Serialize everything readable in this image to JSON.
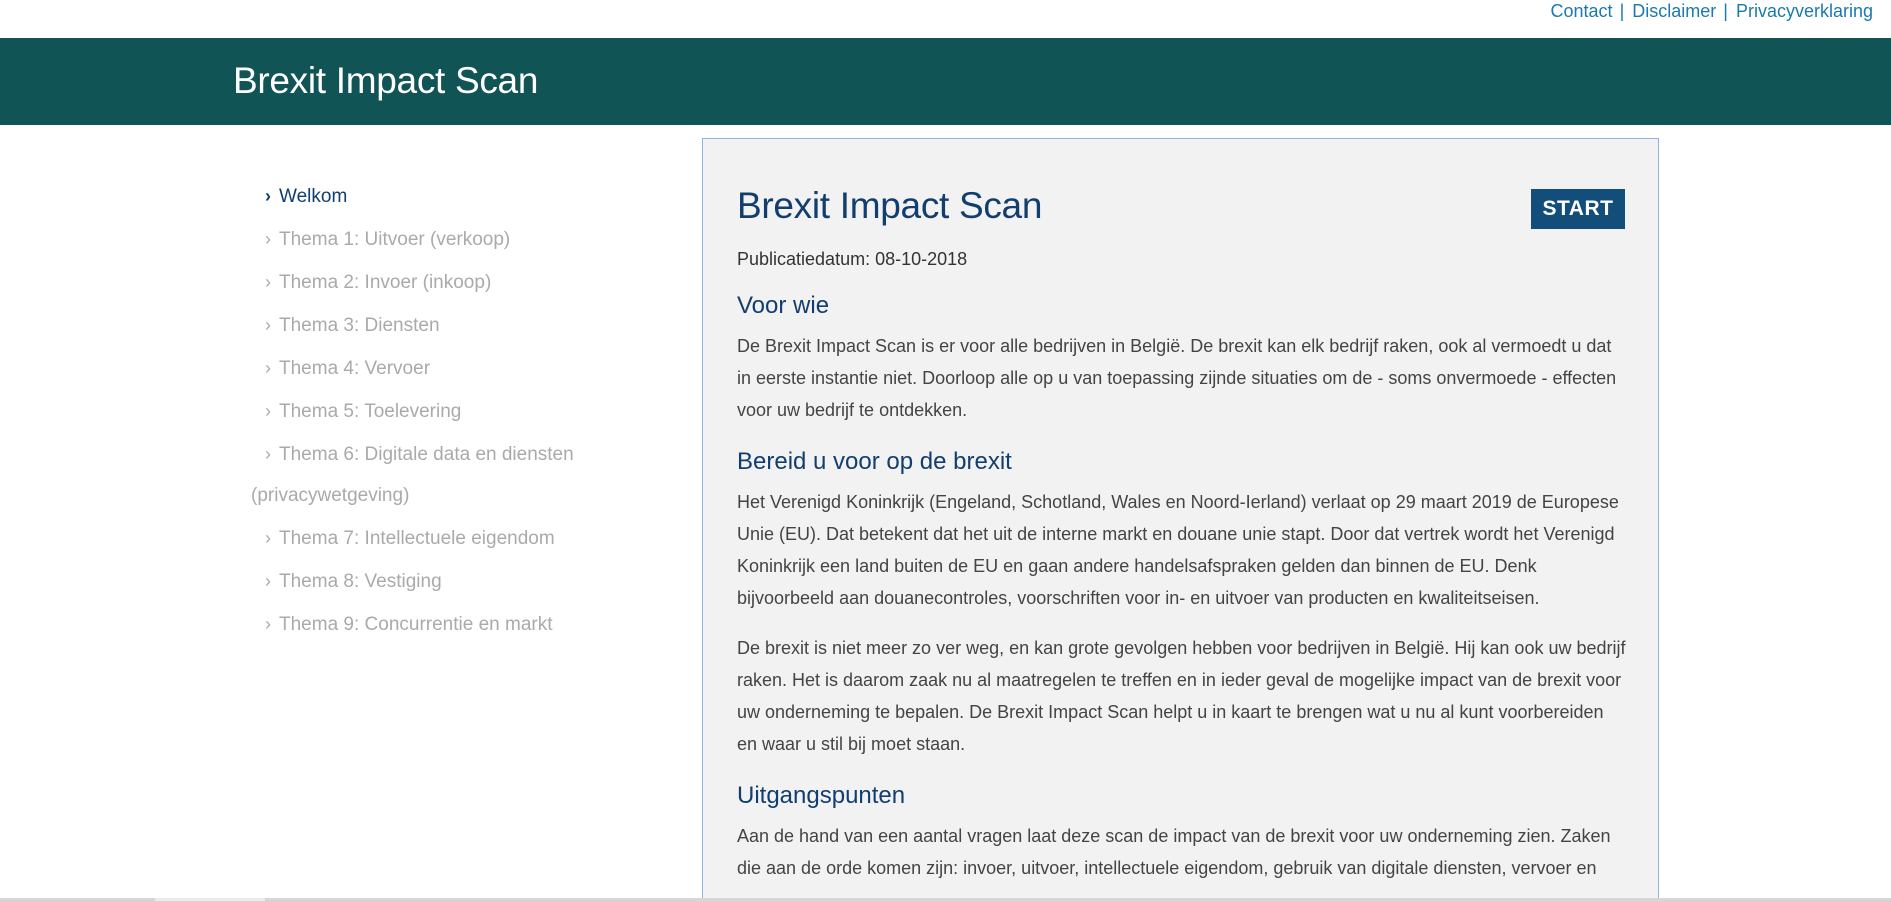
{
  "toplinks": {
    "contact": "Contact",
    "disclaimer": "Disclaimer",
    "privacy": "Privacyverklaring",
    "separator": "|"
  },
  "header": {
    "brand": "Brexit Impact Scan"
  },
  "sidebar": {
    "items": [
      {
        "label": "Welkom",
        "active": true
      },
      {
        "label": "Thema 1: Uitvoer (verkoop)",
        "active": false
      },
      {
        "label": "Thema 2: Invoer (inkoop)",
        "active": false
      },
      {
        "label": "Thema 3: Diensten",
        "active": false
      },
      {
        "label": "Thema 4: Vervoer",
        "active": false
      },
      {
        "label": "Thema 5: Toelevering",
        "active": false
      },
      {
        "label": "Thema 6: Digitale data en diensten",
        "label_cont": "(privacywetgeving)",
        "active": false
      },
      {
        "label": "Thema 7: Intellectuele eigendom",
        "active": false
      },
      {
        "label": "Thema 8: Vestiging",
        "active": false
      },
      {
        "label": "Thema 9: Concurrentie en markt",
        "active": false
      }
    ],
    "chevron": "›"
  },
  "main": {
    "title": "Brexit Impact Scan",
    "start_label": "START",
    "pubdate": "Publicatiedatum: 08-10-2018",
    "sections": [
      {
        "heading": "Voor wie",
        "paragraphs": [
          "De Brexit Impact Scan is er voor alle bedrijven in België. De brexit kan elk bedrijf raken, ook al vermoedt u dat in eerste instantie niet. Doorloop alle op u van toepassing zijnde situaties om de - soms onvermoede - effecten voor uw bedrijf te ontdekken."
        ]
      },
      {
        "heading": "Bereid u voor op de brexit",
        "paragraphs": [
          "Het Verenigd Koninkrijk (Engeland, Schotland, Wales en Noord-Ierland) verlaat op 29 maart 2019 de Europese Unie (EU). Dat betekent dat het uit de interne markt en douane unie stapt. Door dat vertrek wordt het Verenigd Koninkrijk een land buiten de EU en gaan andere handelsafspraken gelden dan binnen de EU. Denk bijvoorbeeld aan douanecontroles, voorschriften voor in- en uitvoer van producten en kwaliteitseisen.",
          "De brexit is niet meer zo ver weg, en kan grote gevolgen hebben voor bedrijven in België. Hij kan ook uw bedrijf raken. Het is daarom zaak nu al maatregelen te treffen en in ieder geval de mogelijke impact van de brexit voor uw onderneming te bepalen. De Brexit Impact Scan helpt u in kaart te brengen wat u nu al kunt voorbereiden en waar u stil bij moet staan."
        ]
      },
      {
        "heading": "Uitgangspunten",
        "paragraphs": [
          "Aan de hand van een aantal vragen laat deze scan de impact van de brexit voor uw onderneming zien. Zaken die aan de orde komen zijn: invoer, uitvoer, intellectuele eigendom, gebruik van digitale diensten, vervoer en"
        ]
      }
    ]
  },
  "colors": {
    "header_bg": "#115456",
    "link": "#1a7ab0",
    "heading": "#123e6f",
    "start_bg": "#134d7a",
    "panel_bg": "#f2f2f2",
    "panel_border": "#8db3e2",
    "nav_inactive": "#aaaaaa"
  }
}
